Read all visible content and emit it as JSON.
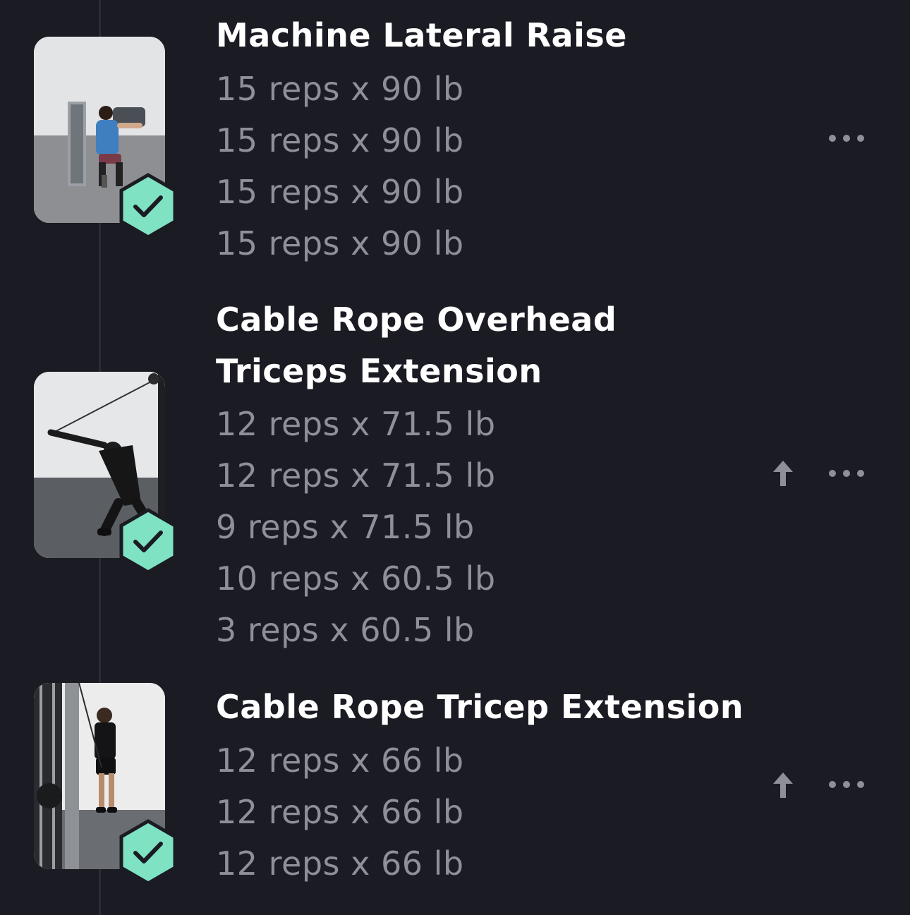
{
  "exercises": [
    {
      "name": "Machine Lateral Raise",
      "image_icon": "machine-lateral-raise-image",
      "completed": true,
      "sets": [
        "15 reps x 90 lb",
        "15 reps x 90 lb",
        "15 reps x 90 lb",
        "15 reps x 90 lb"
      ],
      "has_move_up": false
    },
    {
      "name_lines": [
        "Cable Rope Overhead",
        "Triceps Extension"
      ],
      "image_icon": "cable-rope-overhead-image",
      "completed": true,
      "sets": [
        "12 reps x 71.5 lb",
        "12 reps x 71.5 lb",
        "9 reps x 71.5 lb",
        "10 reps x 60.5 lb",
        "3 reps x 60.5 lb"
      ],
      "has_move_up": true
    },
    {
      "name": "Cable Rope Tricep Extension",
      "image_icon": "cable-rope-tricep-image",
      "completed": true,
      "sets": [
        "12 reps x 66 lb",
        "12 reps x 66 lb",
        "12 reps x 66 lb"
      ],
      "has_move_up": true
    }
  ],
  "icons": {
    "completed": "check-hexagon-icon",
    "more": "more-horizontal-icon",
    "move_up": "arrow-up-icon"
  },
  "colors": {
    "background": "#1b1b24",
    "title": "#ffffff",
    "set_text": "#8f8f9a",
    "badge_fill": "#7fe3c3",
    "badge_stroke": "#1b1b24",
    "icon": "#8f8f9a"
  }
}
